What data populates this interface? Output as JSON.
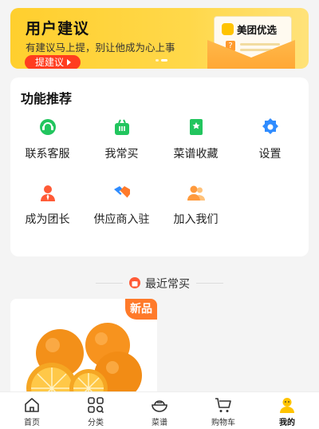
{
  "banner": {
    "title": "用户建议",
    "subtitle": "有建议马上提，别让他成为心上事",
    "button_label": "提建议",
    "brand": "美团优选",
    "slide_count": 2,
    "active_slide": 2,
    "colors": {
      "background": "#ffd23a",
      "button": "#ff3d1f"
    }
  },
  "features": {
    "title": "功能推荐",
    "items": [
      {
        "label": "联系客服",
        "icon": "customer-service-icon",
        "color": "#22c55e"
      },
      {
        "label": "我常买",
        "icon": "shopping-basket-icon",
        "color": "#22c55e"
      },
      {
        "label": "菜谱收藏",
        "icon": "recipe-book-icon",
        "color": "#22c55e"
      },
      {
        "label": "设置",
        "icon": "gear-icon",
        "color": "#2f8cff"
      },
      {
        "label": "成为团长",
        "icon": "leader-icon",
        "color": "#ff5a36"
      },
      {
        "label": "供应商入驻",
        "icon": "handshake-icon",
        "color": "#2f8cff"
      },
      {
        "label": "加入我们",
        "icon": "team-icon",
        "color": "#ff9a3c"
      }
    ]
  },
  "recent": {
    "title": "最近常买",
    "icon": "bag-icon"
  },
  "product": {
    "badge": "新品",
    "image": "oranges-image"
  },
  "tabbar": {
    "items": [
      {
        "label": "首页",
        "icon": "home-icon"
      },
      {
        "label": "分类",
        "icon": "category-icon"
      },
      {
        "label": "菜谱",
        "icon": "recipe-bowl-icon"
      },
      {
        "label": "购物车",
        "icon": "cart-icon"
      },
      {
        "label": "我的",
        "icon": "profile-icon",
        "active": true
      }
    ],
    "active_color": "#ffc300"
  }
}
